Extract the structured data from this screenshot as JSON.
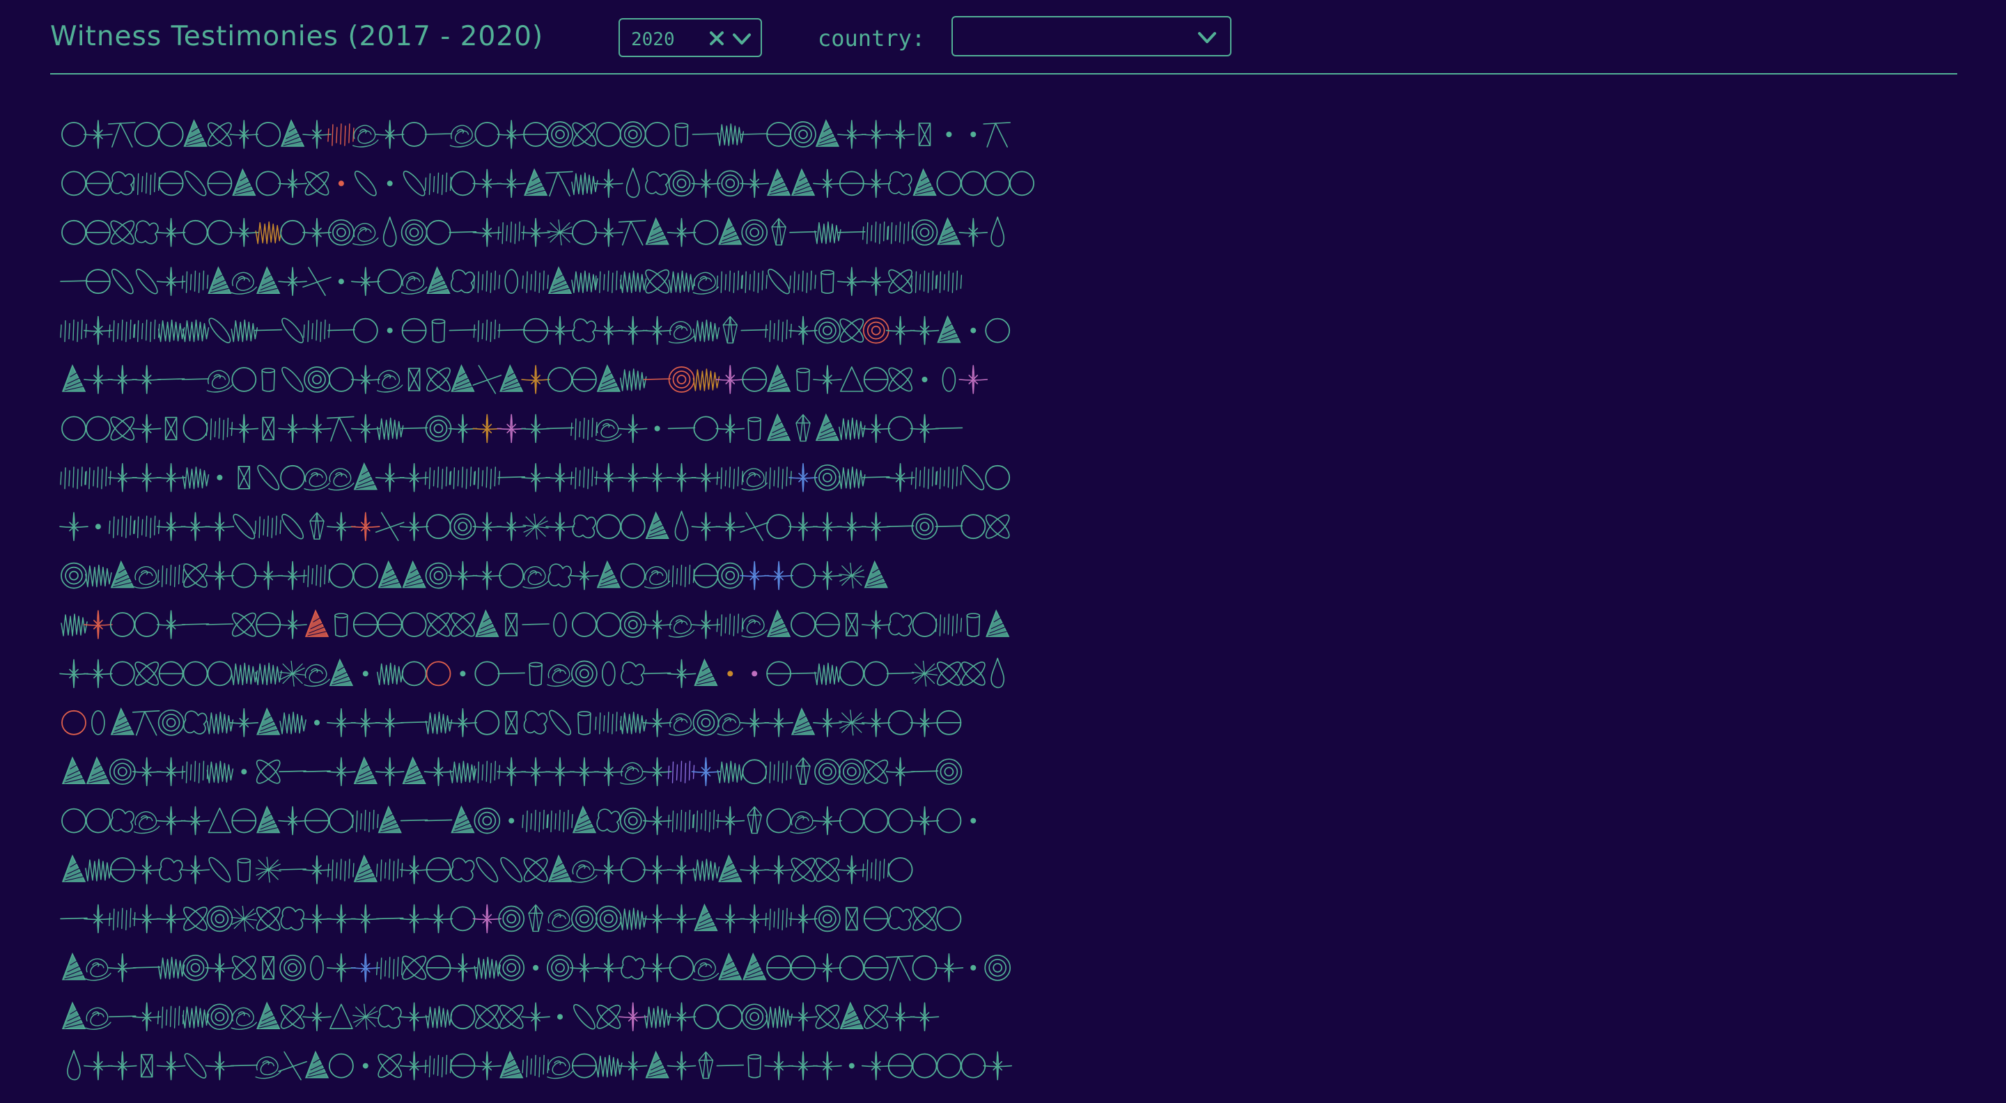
{
  "header": {
    "title": "Witness Testimonies (2017 - 2020)",
    "year_filter": {
      "value": "2020"
    },
    "country_filter": {
      "label": "country:",
      "value": ""
    }
  },
  "colors": {
    "background": "#16053f",
    "accent": "#52b096",
    "highlight_red": "#e0604c",
    "highlight_orange": "#c88a2c",
    "highlight_pink": "#c070c0",
    "highlight_blue": "#5a8ae0",
    "highlight_purple": "#8a70e0"
  },
  "icons": [
    "clear-icon",
    "chevron-down-icon"
  ],
  "glyph_types": [
    "circle",
    "sparkle",
    "tee",
    "triangle",
    "cross-ellipse",
    "scribble",
    "swirl",
    "dash",
    "zigzag",
    "split-circle",
    "target",
    "cylinder",
    "dot",
    "blob",
    "leaf",
    "drop",
    "rect-x",
    "gem",
    "burst",
    "slash-x",
    "ellipse",
    "triangle-outline"
  ],
  "grid_rows": [
    [
      "circle",
      "sparkle",
      "tee",
      "circle",
      "circle",
      "triangle",
      "cross-ellipse",
      "sparkle",
      "circle",
      "triangle",
      "sparkle",
      "scribble:red",
      "swirl",
      "sparkle",
      "circle",
      "dash",
      "swirl",
      "circle",
      "sparkle",
      "split-circle",
      "target",
      "cross-ellipse",
      "circle",
      "target",
      "circle",
      "cylinder",
      "dash",
      "zigzag",
      "dash",
      "split-circle",
      "target",
      "triangle",
      "sparkle",
      "sparkle",
      "sparkle",
      "rect-x",
      "dot",
      "dot",
      "tee"
    ],
    [
      "circle",
      "split-circle",
      "blob",
      "scribble",
      "split-circle",
      "leaf",
      "split-circle",
      "triangle",
      "circle",
      "sparkle",
      "cross-ellipse",
      "dot:red",
      "leaf",
      "dot",
      "leaf",
      "scribble",
      "circle",
      "sparkle",
      "sparkle",
      "triangle",
      "tee",
      "zigzag",
      "sparkle",
      "drop",
      "blob",
      "target",
      "sparkle",
      "target",
      "sparkle",
      "triangle",
      "triangle",
      "sparkle",
      "split-circle",
      "sparkle",
      "blob",
      "triangle",
      "circle",
      "circle",
      "circle",
      "circle"
    ],
    [
      "circle",
      "split-circle",
      "cross-ellipse",
      "blob",
      "sparkle",
      "circle",
      "circle",
      "sparkle",
      "zigzag:orange",
      "circle",
      "sparkle",
      "target",
      "swirl",
      "drop",
      "target",
      "circle",
      "dash",
      "sparkle",
      "scribble",
      "sparkle",
      "burst",
      "circle",
      "sparkle",
      "tee",
      "triangle",
      "sparkle",
      "circle",
      "triangle",
      "target",
      "gem",
      "dash",
      "zigzag",
      "dash",
      "scribble",
      "scribble",
      "target",
      "triangle",
      "sparkle",
      "drop"
    ],
    [
      "dash",
      "split-circle",
      "leaf",
      "leaf",
      "sparkle",
      "scribble",
      "triangle",
      "swirl",
      "triangle",
      "sparkle",
      "slash-x",
      "dot",
      "sparkle",
      "circle",
      "swirl",
      "triangle",
      "blob",
      "scribble",
      "ellipse",
      "scribble",
      "triangle",
      "zigzag",
      "scribble",
      "zigzag",
      "cross-ellipse",
      "zigzag",
      "swirl",
      "scribble",
      "scribble",
      "leaf",
      "scribble",
      "cylinder",
      "sparkle",
      "sparkle",
      "cross-ellipse",
      "scribble",
      "scribble"
    ],
    [
      "scribble",
      "sparkle",
      "scribble",
      "scribble",
      "zigzag",
      "zigzag",
      "leaf",
      "zigzag",
      "dash",
      "leaf",
      "scribble",
      "dash",
      "circle",
      "dot",
      "split-circle",
      "cylinder",
      "dash",
      "scribble",
      "dash",
      "split-circle",
      "sparkle",
      "blob",
      "sparkle",
      "sparkle",
      "sparkle",
      "swirl",
      "zigzag",
      "gem",
      "dash",
      "scribble",
      "sparkle",
      "target",
      "cross-ellipse",
      "target:red",
      "sparkle",
      "sparkle",
      "triangle",
      "dot",
      "circle"
    ],
    [
      "triangle",
      "sparkle",
      "sparkle",
      "sparkle",
      "dash",
      "dash",
      "swirl",
      "circle",
      "cylinder",
      "leaf",
      "target",
      "circle",
      "sparkle",
      "swirl",
      "rect-x",
      "cross-ellipse",
      "triangle",
      "slash-x",
      "triangle",
      "sparkle:orange",
      "circle",
      "split-circle",
      "triangle",
      "zigzag",
      "dash:red",
      "target:red",
      "zigzag:orange",
      "sparkle:pink",
      "split-circle",
      "triangle",
      "cylinder",
      "sparkle",
      "triangle-outline",
      "split-circle",
      "cross-ellipse",
      "dot",
      "ellipse",
      "sparkle:pink"
    ],
    [
      "circle",
      "circle",
      "cross-ellipse",
      "sparkle",
      "rect-x",
      "circle",
      "scribble",
      "sparkle",
      "rect-x",
      "sparkle",
      "sparkle",
      "tee",
      "sparkle",
      "zigzag",
      "dash",
      "target",
      "sparkle",
      "sparkle:orange",
      "sparkle:pink",
      "sparkle",
      "dash",
      "scribble",
      "swirl",
      "sparkle",
      "dot",
      "dash",
      "circle",
      "sparkle",
      "cylinder",
      "triangle",
      "gem",
      "triangle",
      "zigzag",
      "sparkle",
      "circle",
      "sparkle",
      "dash"
    ],
    [
      "scribble",
      "scribble",
      "sparkle",
      "sparkle",
      "sparkle",
      "zigzag",
      "dot",
      "rect-x",
      "leaf",
      "circle",
      "swirl",
      "swirl",
      "triangle",
      "sparkle",
      "sparkle",
      "scribble",
      "scribble",
      "scribble",
      "dash",
      "sparkle",
      "sparkle",
      "scribble",
      "sparkle",
      "sparkle",
      "sparkle",
      "sparkle",
      "sparkle",
      "scribble",
      "swirl",
      "scribble",
      "sparkle:blue",
      "target",
      "zigzag",
      "dash",
      "sparkle",
      "scribble",
      "scribble",
      "leaf",
      "circle"
    ],
    [
      "sparkle",
      "dot",
      "scribble",
      "scribble",
      "sparkle",
      "sparkle",
      "sparkle",
      "leaf",
      "scribble",
      "leaf",
      "gem",
      "sparkle",
      "sparkle:red",
      "slash-x",
      "sparkle",
      "circle",
      "target",
      "sparkle",
      "sparkle",
      "burst",
      "sparkle",
      "blob",
      "circle",
      "circle",
      "triangle",
      "drop",
      "sparkle",
      "sparkle",
      "slash-x",
      "circle",
      "sparkle",
      "sparkle",
      "sparkle",
      "sparkle",
      "dash",
      "target",
      "dash",
      "circle",
      "cross-ellipse"
    ],
    [
      "target",
      "zigzag",
      "triangle",
      "swirl",
      "scribble",
      "cross-ellipse",
      "sparkle",
      "circle",
      "sparkle",
      "sparkle",
      "scribble",
      "circle",
      "circle",
      "triangle",
      "triangle",
      "target",
      "sparkle",
      "sparkle",
      "circle",
      "swirl",
      "blob",
      "sparkle",
      "triangle",
      "circle",
      "swirl",
      "scribble",
      "split-circle",
      "target",
      "sparkle:blue",
      "sparkle:blue",
      "circle",
      "sparkle",
      "burst",
      "triangle"
    ],
    [
      "zigzag",
      "sparkle:red",
      "circle",
      "circle",
      "sparkle",
      "dash",
      "dash",
      "cross-ellipse",
      "split-circle",
      "sparkle",
      "triangle:red",
      "cylinder",
      "split-circle",
      "split-circle",
      "circle",
      "cross-ellipse",
      "cross-ellipse",
      "triangle",
      "rect-x",
      "dash",
      "ellipse",
      "circle",
      "circle",
      "target",
      "sparkle",
      "swirl",
      "sparkle",
      "scribble",
      "swirl",
      "triangle",
      "circle",
      "split-circle",
      "rect-x",
      "sparkle",
      "blob",
      "circle",
      "scribble",
      "cylinder",
      "triangle"
    ],
    [
      "sparkle",
      "sparkle",
      "circle",
      "cross-ellipse",
      "split-circle",
      "circle",
      "circle",
      "zigzag",
      "zigzag",
      "burst",
      "swirl",
      "triangle",
      "dot",
      "zigzag",
      "circle",
      "circle:red",
      "dot",
      "circle",
      "dash",
      "cylinder",
      "swirl",
      "target",
      "ellipse",
      "blob",
      "dash",
      "sparkle",
      "triangle",
      "dot:orange",
      "dot:pink",
      "split-circle",
      "dash",
      "zigzag",
      "circle",
      "circle",
      "dash",
      "burst",
      "cross-ellipse",
      "cross-ellipse",
      "drop"
    ],
    [
      "circle:red",
      "ellipse",
      "triangle",
      "tee",
      "target",
      "blob",
      "zigzag",
      "sparkle",
      "triangle",
      "zigzag",
      "dot",
      "sparkle",
      "sparkle",
      "sparkle",
      "dash",
      "zigzag",
      "sparkle",
      "circle",
      "rect-x",
      "blob",
      "leaf",
      "cylinder",
      "scribble",
      "zigzag",
      "sparkle",
      "swirl",
      "target",
      "swirl",
      "sparkle",
      "sparkle",
      "triangle",
      "sparkle",
      "burst",
      "sparkle",
      "circle",
      "sparkle",
      "split-circle"
    ],
    [
      "triangle",
      "triangle",
      "target",
      "sparkle",
      "sparkle",
      "scribble",
      "zigzag",
      "dot",
      "cross-ellipse",
      "dash",
      "dash",
      "sparkle",
      "triangle",
      "sparkle",
      "triangle",
      "sparkle",
      "zigzag",
      "scribble",
      "sparkle",
      "sparkle",
      "sparkle",
      "sparkle",
      "sparkle",
      "swirl",
      "sparkle",
      "scribble:purple",
      "sparkle:blue",
      "zigzag",
      "circle",
      "scribble",
      "gem",
      "target",
      "target",
      "cross-ellipse",
      "sparkle",
      "dash",
      "target"
    ],
    [
      "circle",
      "circle",
      "blob",
      "swirl",
      "sparkle",
      "sparkle",
      "triangle-outline",
      "split-circle",
      "triangle",
      "sparkle",
      "split-circle",
      "circle",
      "scribble",
      "triangle",
      "dash",
      "dash",
      "triangle",
      "target",
      "dot",
      "scribble",
      "scribble",
      "triangle",
      "blob",
      "target",
      "sparkle",
      "scribble",
      "scribble",
      "sparkle",
      "gem",
      "circle",
      "swirl",
      "sparkle",
      "circle",
      "circle",
      "circle",
      "sparkle",
      "circle",
      "dot"
    ],
    [
      "triangle",
      "zigzag",
      "split-circle",
      "sparkle",
      "blob",
      "sparkle",
      "leaf",
      "cylinder",
      "burst",
      "dash",
      "sparkle",
      "scribble",
      "triangle",
      "scribble",
      "sparkle",
      "split-circle",
      "blob",
      "leaf",
      "leaf",
      "cross-ellipse",
      "triangle",
      "swirl",
      "sparkle",
      "circle",
      "sparkle",
      "sparkle",
      "zigzag",
      "triangle",
      "sparkle",
      "sparkle",
      "cross-ellipse",
      "cross-ellipse",
      "sparkle",
      "scribble",
      "circle"
    ],
    [
      "dash",
      "sparkle",
      "scribble",
      "sparkle",
      "sparkle",
      "cross-ellipse",
      "target",
      "burst",
      "cross-ellipse",
      "blob",
      "sparkle",
      "sparkle",
      "sparkle",
      "dash",
      "sparkle",
      "sparkle",
      "circle",
      "sparkle:pink",
      "target",
      "gem",
      "swirl",
      "target",
      "target",
      "zigzag",
      "sparkle",
      "sparkle",
      "triangle",
      "sparkle",
      "sparkle",
      "scribble",
      "sparkle",
      "target",
      "rect-x",
      "split-circle",
      "blob",
      "cross-ellipse",
      "circle"
    ],
    [
      "triangle",
      "swirl",
      "sparkle",
      "dash",
      "zigzag",
      "target",
      "sparkle",
      "cross-ellipse",
      "rect-x",
      "target",
      "ellipse",
      "sparkle",
      "sparkle:blue",
      "scribble",
      "cross-ellipse",
      "split-circle",
      "sparkle",
      "zigzag",
      "target",
      "dot",
      "target",
      "sparkle",
      "sparkle",
      "blob",
      "sparkle",
      "circle",
      "swirl",
      "triangle",
      "triangle",
      "split-circle",
      "split-circle",
      "sparkle",
      "circle",
      "split-circle",
      "tee",
      "circle",
      "sparkle",
      "dot",
      "target"
    ],
    [
      "triangle",
      "swirl",
      "dash",
      "sparkle",
      "scribble",
      "zigzag",
      "target",
      "swirl",
      "triangle",
      "cross-ellipse",
      "sparkle",
      "triangle-outline",
      "burst",
      "blob",
      "sparkle",
      "zigzag",
      "circle",
      "cross-ellipse",
      "cross-ellipse",
      "sparkle",
      "dot",
      "leaf",
      "cross-ellipse",
      "sparkle:pink",
      "zigzag",
      "sparkle",
      "circle",
      "circle",
      "target",
      "zigzag",
      "sparkle",
      "cross-ellipse",
      "triangle",
      "cross-ellipse",
      "sparkle",
      "sparkle"
    ],
    [
      "drop",
      "sparkle",
      "sparkle",
      "rect-x",
      "sparkle",
      "leaf",
      "sparkle",
      "dash",
      "swirl",
      "slash-x",
      "triangle",
      "circle",
      "dot",
      "cross-ellipse",
      "sparkle",
      "scribble",
      "split-circle",
      "sparkle",
      "triangle",
      "scribble",
      "swirl",
      "split-circle",
      "zigzag",
      "sparkle",
      "triangle",
      "sparkle",
      "gem",
      "dash",
      "cylinder",
      "sparkle",
      "sparkle",
      "sparkle",
      "dot",
      "sparkle",
      "split-circle",
      "circle",
      "circle",
      "circle",
      "sparkle"
    ]
  ]
}
